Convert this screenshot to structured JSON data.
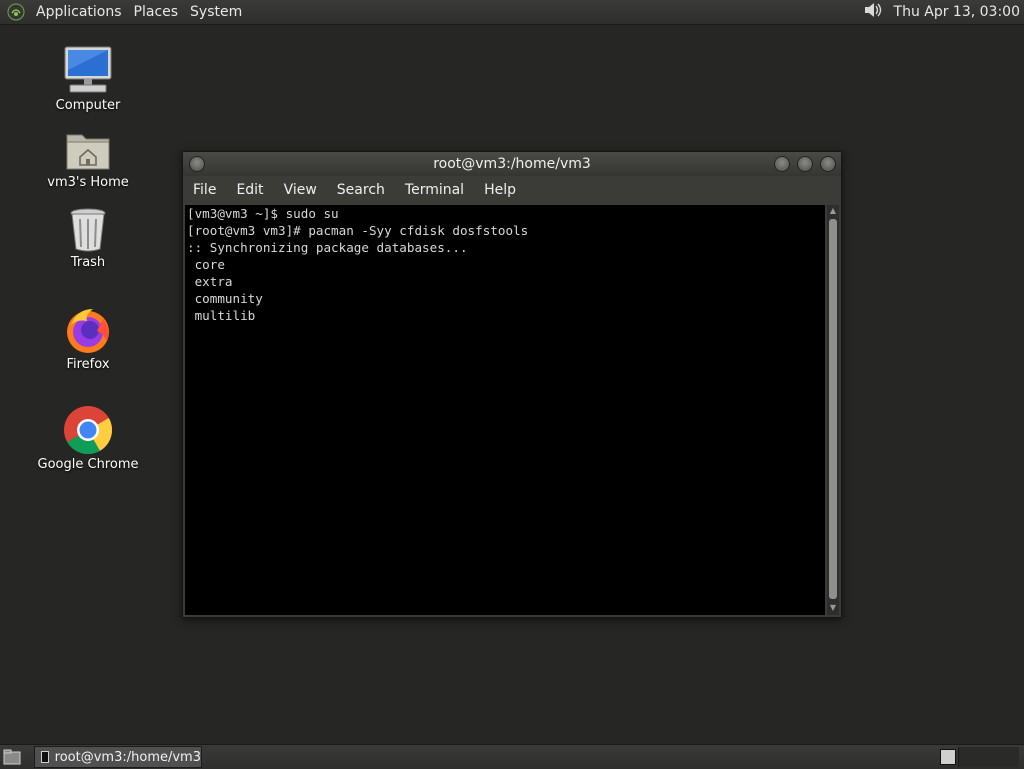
{
  "top_panel": {
    "menus": [
      "Applications",
      "Places",
      "System"
    ],
    "clock": "Thu Apr 13, 03:00",
    "icons": {
      "logo": "gnome-foot-icon",
      "volume": "volume-icon"
    }
  },
  "desktop_icons": [
    {
      "label": "Computer",
      "icon": "computer-icon"
    },
    {
      "label": "vm3's Home",
      "icon": "home-folder-icon"
    },
    {
      "label": "Trash",
      "icon": "trash-icon"
    },
    {
      "label": "Firefox",
      "icon": "firefox-icon"
    },
    {
      "label": "Google Chrome",
      "icon": "chrome-icon"
    }
  ],
  "window": {
    "title": "root@vm3:/home/vm3",
    "menu": [
      "File",
      "Edit",
      "View",
      "Search",
      "Terminal",
      "Help"
    ],
    "terminal_lines": [
      "[vm3@vm3 ~]$ sudo su",
      "[root@vm3 vm3]# pacman -Syy cfdisk dosfstools",
      ":: Synchronizing package databases...",
      " core",
      " extra",
      " community",
      " multilib"
    ]
  },
  "taskbar": {
    "task_label": "root@vm3:/home/vm3"
  },
  "colors": {
    "desktop_bg": "#262724",
    "terminal_bg": "#000000",
    "terminal_fg": "#d8d8d8"
  }
}
